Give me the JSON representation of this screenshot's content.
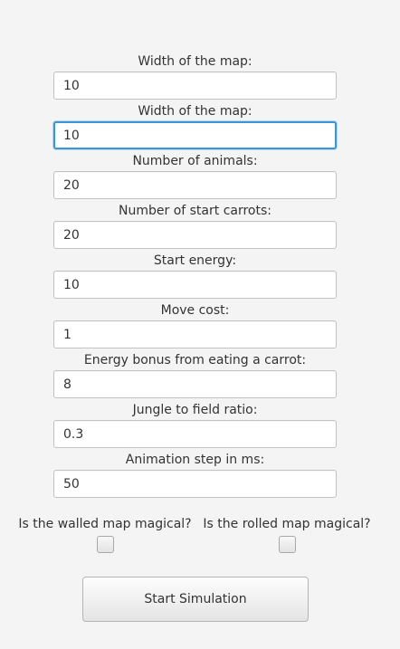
{
  "form": {
    "fields": [
      {
        "label": "Width of the map:",
        "value": "10"
      },
      {
        "label": "Width of the map:",
        "value": "10"
      },
      {
        "label": "Number of animals:",
        "value": "20"
      },
      {
        "label": "Number of start carrots:",
        "value": "20"
      },
      {
        "label": "Start energy:",
        "value": "10"
      },
      {
        "label": "Move cost:",
        "value": "1"
      },
      {
        "label": "Energy bonus from eating a carrot:",
        "value": "8"
      },
      {
        "label": "Jungle to field ratio:",
        "value": "0.3"
      },
      {
        "label": "Animation step in ms:",
        "value": "50"
      }
    ]
  },
  "options": {
    "walled_magical": {
      "label": "Is the walled map magical?",
      "checked": false
    },
    "rolled_magical": {
      "label": "Is the rolled map magical?",
      "checked": false
    }
  },
  "actions": {
    "start_label": "Start Simulation"
  },
  "colors": {
    "background": "#f4f4f4",
    "focus_border": "#3d95d6",
    "field_border": "#c2c2c2"
  }
}
